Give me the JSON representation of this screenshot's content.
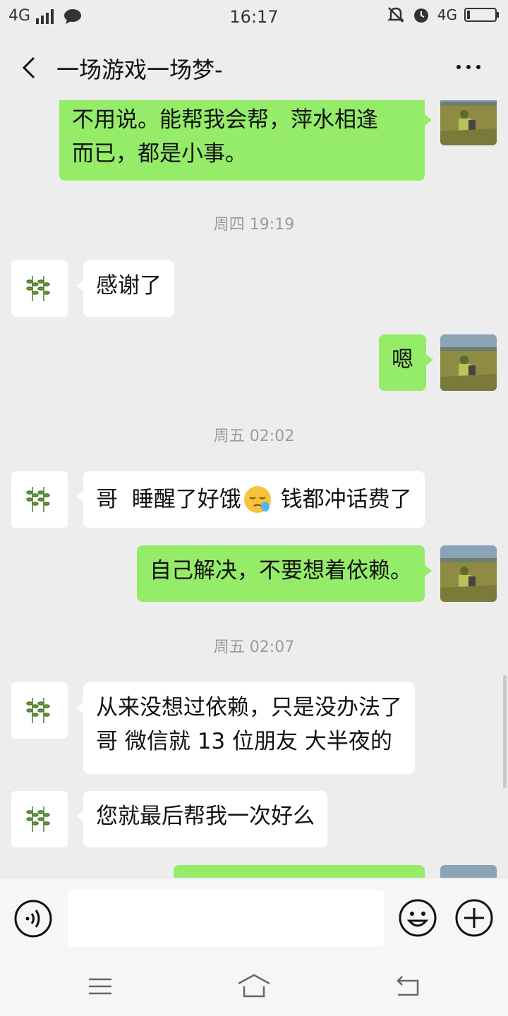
{
  "status_bar": {
    "time": "16:17",
    "network_left": "4G",
    "network_right": "4G"
  },
  "header": {
    "title": "一场游戏一场梦-",
    "back_icon": "chevron-left-icon",
    "more_icon": "more-dots-icon"
  },
  "messages": [
    {
      "from": "me",
      "lines": [
        "不用说。能帮我会帮，萍水相逢",
        "而已，都是小事。"
      ]
    },
    {
      "type": "time",
      "text": "周四 19:19"
    },
    {
      "from": "friend",
      "lines": [
        "感谢了"
      ]
    },
    {
      "from": "me",
      "lines": [
        "嗯"
      ]
    },
    {
      "type": "time",
      "text": "周五 02:02"
    },
    {
      "from": "friend",
      "before_emoji": "哥  睡醒了好饿",
      "emoji": "sleepy-face",
      "after_emoji": " 钱都冲话费了"
    },
    {
      "from": "me",
      "lines": [
        "自己解决，不要想着依赖。"
      ]
    },
    {
      "type": "time",
      "text": "周五 02:07"
    },
    {
      "from": "friend",
      "lines": [
        "从来没想过依赖，只是没办法了",
        "哥  微信就 13 位朋友 大半夜的"
      ]
    },
    {
      "from": "friend",
      "lines": [
        "您就最后帮我一次好么"
      ]
    },
    {
      "from": "me",
      "lines": [
        ""
      ]
    }
  ],
  "input_bar": {
    "placeholder": "",
    "voice_icon": "voice-icon",
    "emoji_icon": "smiley-icon",
    "plus_icon": "plus-icon"
  },
  "nav_bar": {
    "menu_icon": "menu-icon",
    "home_icon": "home-icon",
    "back_icon": "back-arrow-icon"
  },
  "colors": {
    "my_bubble": "#95ec69",
    "friend_bubble": "#ffffff",
    "background": "#ededed"
  }
}
